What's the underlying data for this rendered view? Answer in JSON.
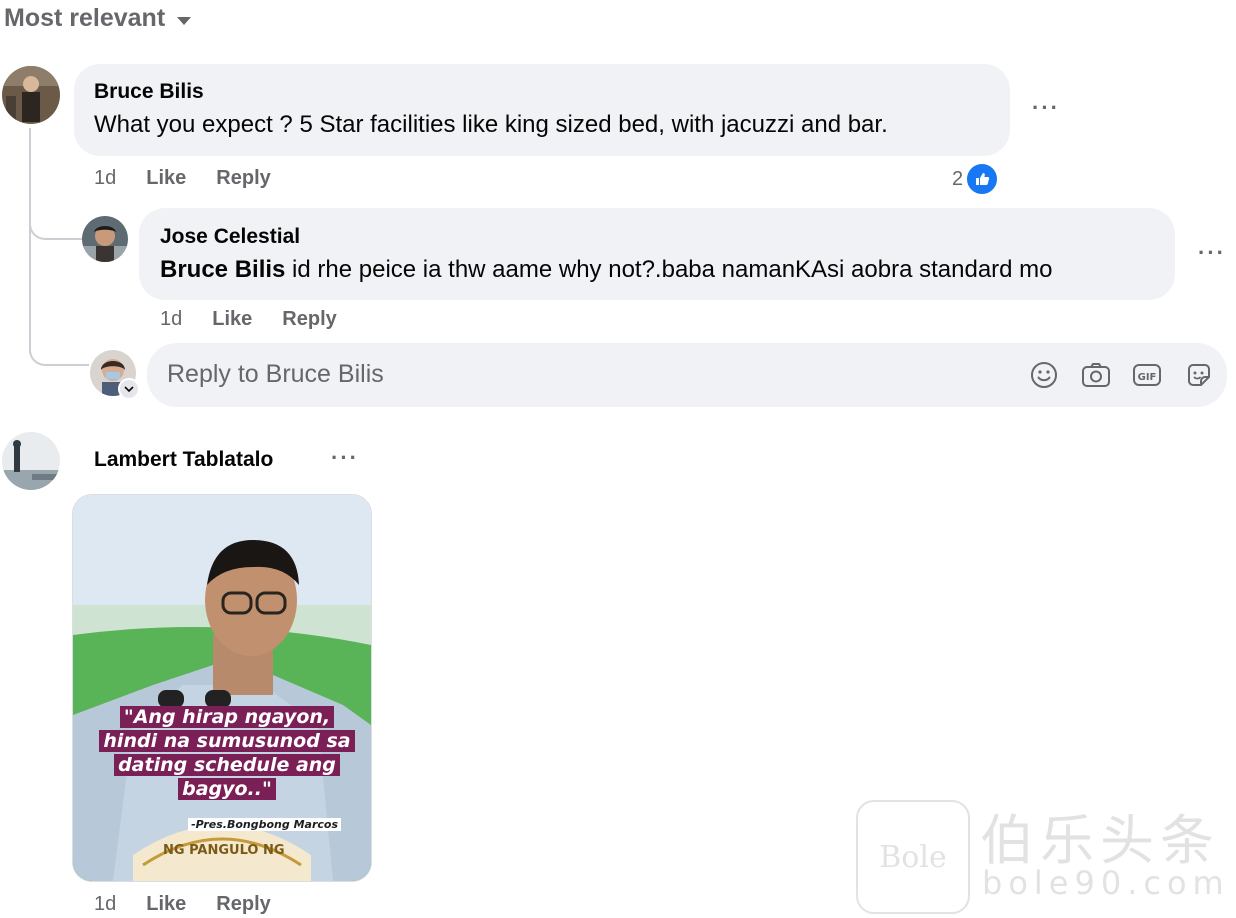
{
  "sort": {
    "label": "Most relevant"
  },
  "comments": [
    {
      "author": "Bruce Bilis",
      "text": "What you expect ? 5 Star facilities like king sized bed, with jacuzzi and bar.",
      "time": "1d",
      "like_label": "Like",
      "reply_label": "Reply",
      "reaction_count": "2",
      "replies": [
        {
          "author": "Jose Celestial",
          "mention": "Bruce Bilis",
          "text": " id rhe peice ia thw aame why not?.baba namanKAsi aobra standard mo",
          "time": "1d",
          "like_label": "Like",
          "reply_label": "Reply"
        }
      ],
      "reply_input": {
        "placeholder": "Reply to Bruce Bilis",
        "tools": [
          "emoji-icon",
          "camera-icon",
          "gif-icon",
          "sticker-icon"
        ],
        "gif_label": "GIF"
      }
    },
    {
      "author": "Lambert Tablatalo",
      "time": "1d",
      "like_label": "Like",
      "reply_label": "Reply",
      "image": {
        "quote_lines": [
          "\"Ang hirap ngayon,",
          "hindi na sumusunod sa",
          "dating schedule ang",
          "bagyo..\""
        ],
        "attribution": "-Pres.Bongbong Marcos",
        "seal_text": "NG PANGULO NG"
      }
    }
  ],
  "more_label": "···",
  "watermark": {
    "text": "伯乐头条",
    "url": "bole90.com",
    "logo": "Bole"
  },
  "colors": {
    "accent": "#1877f2",
    "bubble": "#f0f2f5",
    "muted": "#65676b",
    "quote_bg": "#7b1f57"
  }
}
